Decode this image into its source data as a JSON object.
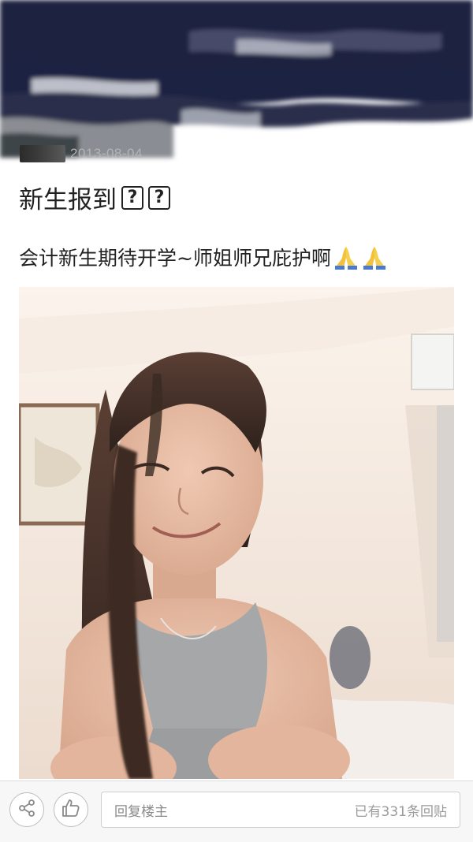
{
  "post": {
    "date": "2013-08-04",
    "title": "新生报到",
    "title_unknown_chars": [
      "?",
      "?"
    ],
    "body": "会计新生期待开学~师姐师兄庇护啊",
    "body_emojis": [
      "folded-hands-emoji",
      "folded-hands-emoji"
    ]
  },
  "photo": {
    "icon": "selfie-photo"
  },
  "footer": {
    "share_icon": "share-icon",
    "like_icon": "thumbs-up-icon",
    "reply_placeholder": "回复楼主",
    "reply_count_text": "已有331条回贴"
  },
  "colors": {
    "redaction": "#1c2140",
    "title_text": "#222222",
    "date_text": "#b3b3b3",
    "footer_bg": "#f7f7f7"
  }
}
